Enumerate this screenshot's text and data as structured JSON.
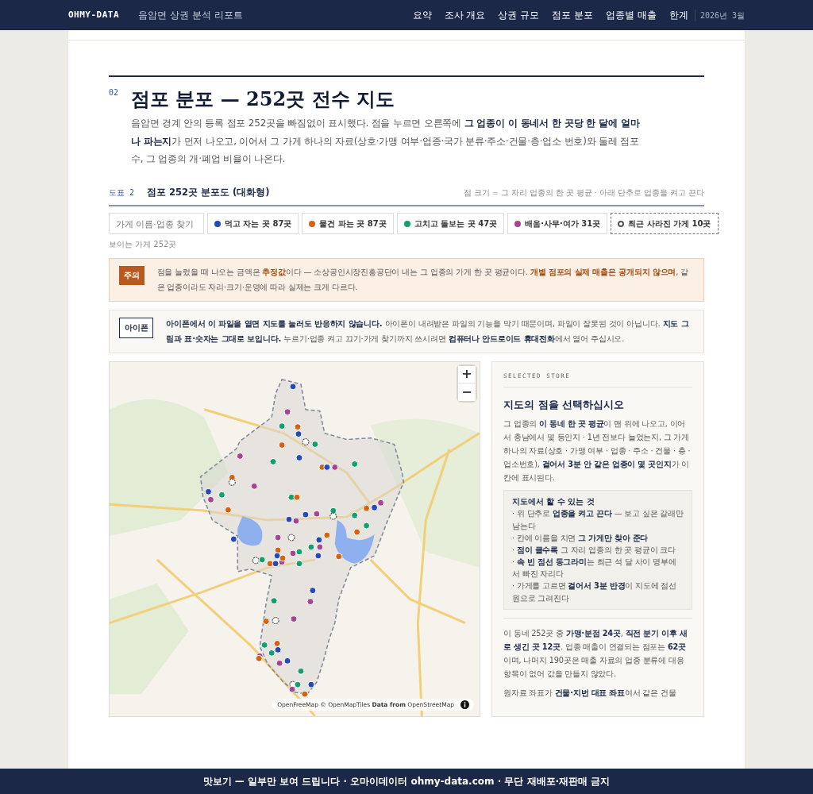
{
  "header": {
    "brand": "OHMY-DATA",
    "subtitle": "음암면 상권 분석 리포트",
    "nav": [
      "요약",
      "조사 개요",
      "상권 규모",
      "점포 분포",
      "업종별 매출",
      "한계"
    ],
    "date": "2026년 3월"
  },
  "section": {
    "number": "02",
    "title": "점포 분포 — 252곳 전수 지도",
    "lead": "음암면 경계 안의 등록 점포 252곳을 빠짐없이 표시했다. 점을 누르면 오른쪽에 **그 업종이 이 동네서 한 곳당 한 달에 얼마나 파는지**가 먼저 나오고, 이어서 그 가게 하나의 자료(상호·가맹 여부·업종·국가 분류·주소·건물·층·업소 번호)와 둘레 점포 수, 그 업종의 개·폐업 비율이 나온다."
  },
  "figure": {
    "label": "도표 2",
    "title": "점포 252곳 분포도 (대화형)",
    "note": "점 크기 = 그 자리 업종의 한 곳 평균 · 아래 단추로 업종을 켜고 끈다"
  },
  "search": {
    "placeholder": "가게 이름·업종 찾기"
  },
  "filters": [
    {
      "kind": "category",
      "label": "먹고 자는 곳 87곳",
      "color": "#2449b8",
      "on": true
    },
    {
      "kind": "category",
      "label": "물건 파는 곳 87곳",
      "color": "#d9620f",
      "on": true
    },
    {
      "kind": "category",
      "label": "고치고 돌보는 곳 47곳",
      "color": "#12a06e",
      "on": true
    },
    {
      "kind": "category",
      "label": "배움·사무·여가 31곳",
      "color": "#a8458f",
      "on": true
    },
    {
      "kind": "closed",
      "label": "최근 사라진 가게 10곳",
      "color": "#555555",
      "on": true
    }
  ],
  "visible_count": "보이는 가게 252곳",
  "notices": [
    {
      "kind": "caution",
      "badge": "주의",
      "text": "점을 눌렀을 때 나오는 금액은 **추정값**이다 — 소상공인시장진흥공단이 내는 그 업종의 가게 한 곳 평균이다. **개별 점포의 실제 매출은 공개되지 않으며**, 같은 업종이라도 자리·크기·운영에 따라 실제는 크게 다르다."
    },
    {
      "kind": "info",
      "badge": "아이폰",
      "text": "**아이폰에서 이 파일을 열면 지도를 눌러도 반응하지 않습니다.** 아이폰이 내려받은 파일의 기능을 막기 때문이며, 파일이 잘못된 것이 아닙니다. **지도 그림과 표·숫자는 그대로 보입니다.** 누르기·업종 켜고 끄기·가게 찾기까지 쓰시려면 **컴퓨터나 안드로이드 휴대전화**에서 열어 주십시오."
    }
  ],
  "map": {
    "zoom_in": "+",
    "zoom_out": "−",
    "attribution": "OpenFreeMap © OpenMapTiles **Data from** OpenStreetMap"
  },
  "sidebar": {
    "eyebrow": "SELECTED STORE",
    "heading": "지도의 점을 선택하십시오",
    "intro": "그 업종의 **이 동네 한 곳 평균**이 맨 위에 나오고, 이어서 충남에서 몇 등인지 · 1년 전보다 늘었는지, 그 가게 하나의 자료(상호 · 가맹 여부 · 업종 · 주소 · 건물 · 층 · 업소번호), **걸어서 3분 안 같은 업종이 몇 곳인지**가 이 칸에 표시된다.",
    "help_title": "지도에서 할 수 있는 것",
    "help_items": [
      "· 위 단추로 **업종을 켜고 끈다** — 보고 싶은 갈래만 남는다",
      "· 칸에 이름을 치면 **그 가게만 찾아 준다**",
      "· **점이 클수록** 그 자리 업종의 한 곳 평균이 크다",
      "· **속 빈 점선 동그라미**는 최근 석 달 사이 명부에서 빠진 자리다",
      "· 가게를 고르면 **걸어서 3분 반경**이 지도에 점선 원으로 그려진다"
    ],
    "paragraphs": [
      "이 동네 252곳 중 **가맹·분점 24곳**, **직전 분기 이후 새로 생긴 곳 12곳**. 업종 매출이 연결되는 점포는 **62곳**이며, 나머지 190곳은 매출 자료의 업종 분류에 대응 항목이 없어 값을 만들지 않았다.",
      "원자료 좌표가 **건물·지번 대표 좌표**여서 같은 건물"
    ]
  },
  "banner": "맛보기 — 일부만 보여 드립니다 · 오마이데이터 ohmy-data.com · 무단 재배포·재판매 금지"
}
